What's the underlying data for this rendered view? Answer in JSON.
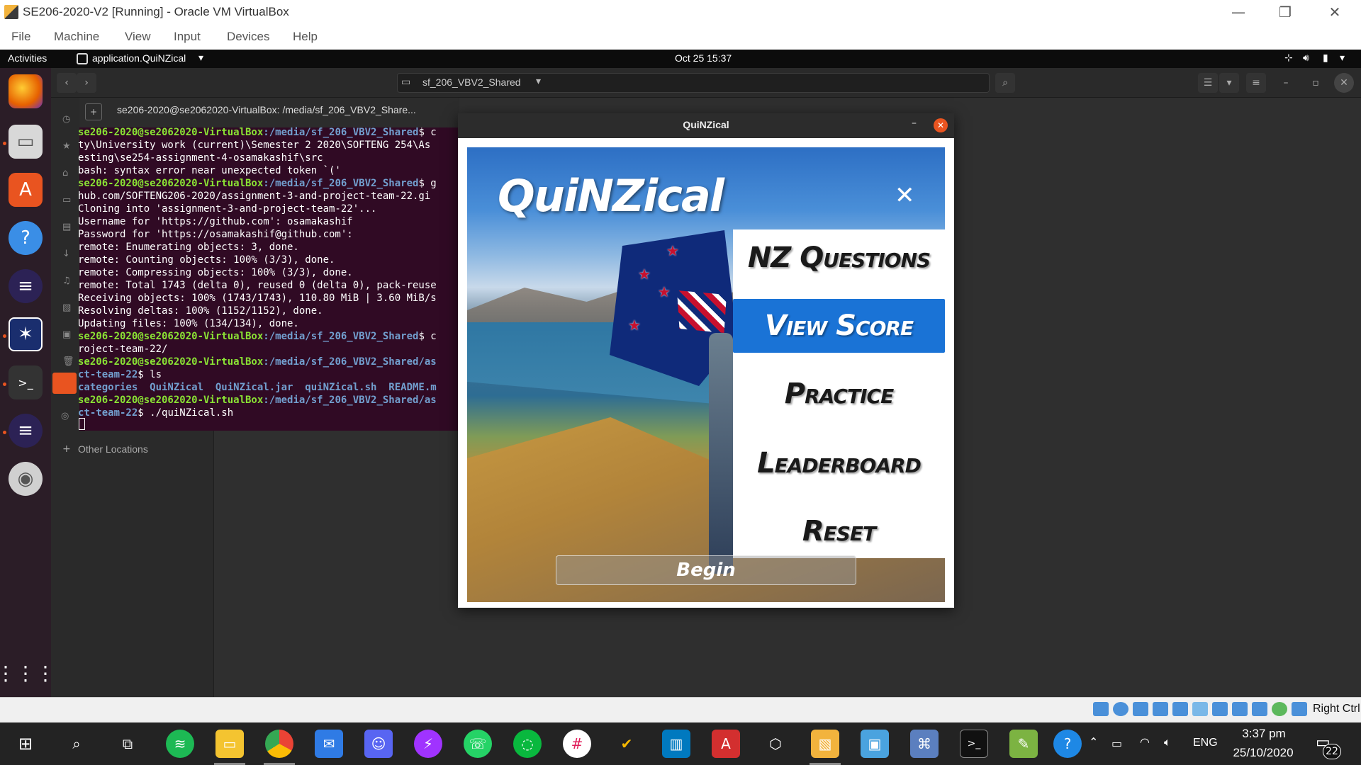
{
  "vbox": {
    "title": "SE206-2020-V2 [Running] - Oracle VM VirtualBox",
    "menu": [
      "File",
      "Machine",
      "View",
      "Input",
      "Devices",
      "Help"
    ],
    "minimize": "—",
    "restore": "❐",
    "close": "✕",
    "host_key": "Right Ctrl"
  },
  "gnome": {
    "activities": "Activities",
    "app_menu": "application.QuiNZical",
    "clock": "Oct 25  15:37"
  },
  "file_manager": {
    "path": "sf_206_VBV2_Shared",
    "other_locations": "Other Locations"
  },
  "terminal": {
    "title": "se206-2020@se2062020-VirtualBox: /media/sf_206_VBV2_Share...",
    "lines": [
      {
        "user": "se206-2020@se2062020-VirtualBox",
        "path": ":/media/sf_206_VBV2_Shared",
        "rest": "$ c"
      },
      {
        "text": "ty\\University work (current)\\Semester 2 2020\\SOFTENG 254\\As"
      },
      {
        "text": "esting\\se254-assignment-4-osamakashif\\src"
      },
      {
        "text": "bash: syntax error near unexpected token `('"
      },
      {
        "user": "se206-2020@se2062020-VirtualBox",
        "path": ":/media/sf_206_VBV2_Shared",
        "rest": "$ g"
      },
      {
        "text": "hub.com/SOFTENG206-2020/assignment-3-and-project-team-22.gi"
      },
      {
        "text": "Cloning into 'assignment-3-and-project-team-22'..."
      },
      {
        "text": "Username for 'https://github.com': osamakashif"
      },
      {
        "text": "Password for 'https://osamakashif@github.com':"
      },
      {
        "text": "remote: Enumerating objects: 3, done."
      },
      {
        "text": "remote: Counting objects: 100% (3/3), done."
      },
      {
        "text": "remote: Compressing objects: 100% (3/3), done."
      },
      {
        "text": "remote: Total 1743 (delta 0), reused 0 (delta 0), pack-reuse"
      },
      {
        "text": "Receiving objects: 100% (1743/1743), 110.80 MiB | 3.60 MiB/s"
      },
      {
        "text": "Resolving deltas: 100% (1152/1152), done."
      },
      {
        "text": "Updating files: 100% (134/134), done."
      },
      {
        "user": "se206-2020@se2062020-VirtualBox",
        "path": ":/media/sf_206_VBV2_Shared",
        "rest": "$ c"
      },
      {
        "text": "roject-team-22/"
      },
      {
        "user": "se206-2020@se2062020-VirtualBox",
        "path": ":/media/sf_206_VBV2_Shared/as",
        "rest": ""
      },
      {
        "path": "ct-team-22",
        "rest": "$ ls"
      },
      {
        "ls": "categories  QuiNZical  QuiNZical.jar  quiNZical.sh  README.m"
      },
      {
        "user": "se206-2020@se2062020-VirtualBox",
        "path": ":/media/sf_206_VBV2_Shared/as",
        "rest": ""
      },
      {
        "path": "ct-team-22",
        "rest": "$ ./quiNZical.sh"
      }
    ]
  },
  "quinzical": {
    "window_title": "QuiNZical",
    "logo": "QuiNZical",
    "close_glyph": "✕",
    "menu": [
      {
        "label": "NZ Questions",
        "active": false
      },
      {
        "label": "View Score",
        "active": true
      },
      {
        "label": "Practice",
        "active": false
      },
      {
        "label": "Leaderboard",
        "active": false
      },
      {
        "label": "Reset",
        "active": false
      }
    ],
    "begin": "Begin"
  },
  "taskbar": {
    "time": "3:37 pm",
    "date": "25/10/2020",
    "lang": "ENG",
    "notifications": "22"
  }
}
